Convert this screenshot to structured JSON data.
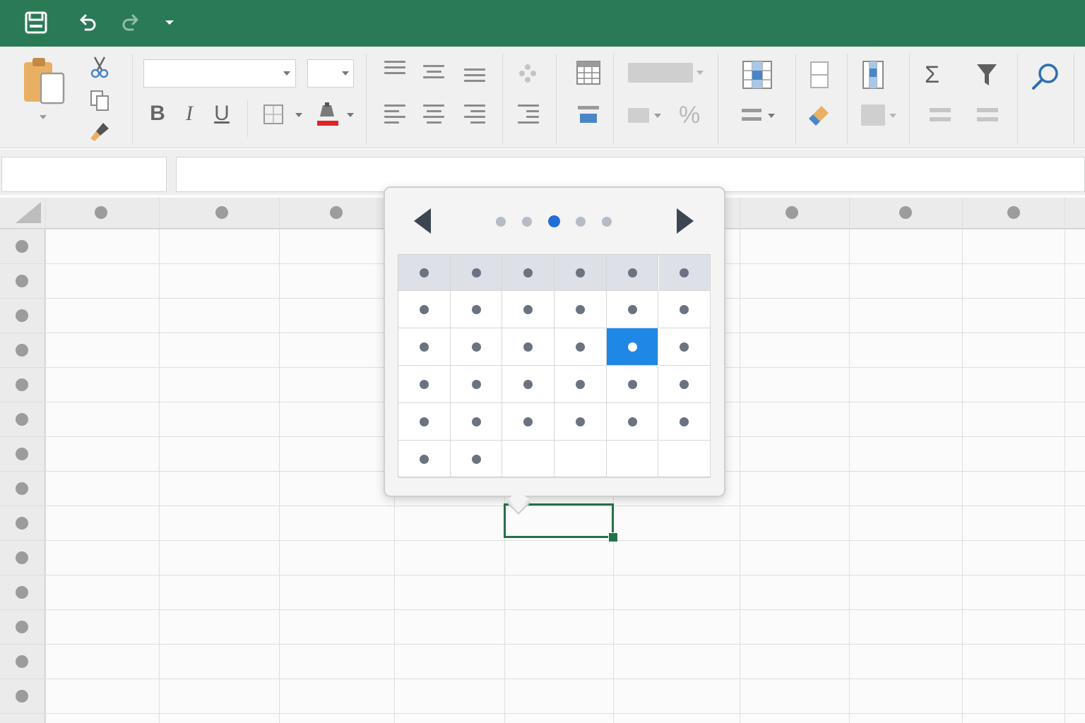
{
  "app": {
    "accent_color": "#2a7a56",
    "selection_color": "#217346"
  },
  "quick_access": [
    {
      "name": "save-icon"
    },
    {
      "name": "undo-icon"
    },
    {
      "name": "redo-icon"
    },
    {
      "name": "customize-dropdown-icon"
    }
  ],
  "ribbon": {
    "font_name": {
      "value": "",
      "placeholder": ""
    },
    "font_size": {
      "value": "",
      "placeholder": ""
    },
    "bold_label": "B",
    "italic_label": "I",
    "underline_label": "U",
    "percent_label": "%",
    "sum_label": "Σ"
  },
  "formula_bar": {
    "name_box": "",
    "formula": ""
  },
  "sheet": {
    "active_cell": ""
  },
  "date_picker": {
    "pages": 5,
    "current_page": 3,
    "week_columns": 6,
    "day_rows": 5,
    "last_row_days": 2,
    "selected_row": 2,
    "selected_col": 5,
    "selected_color": "#1f87e5"
  }
}
